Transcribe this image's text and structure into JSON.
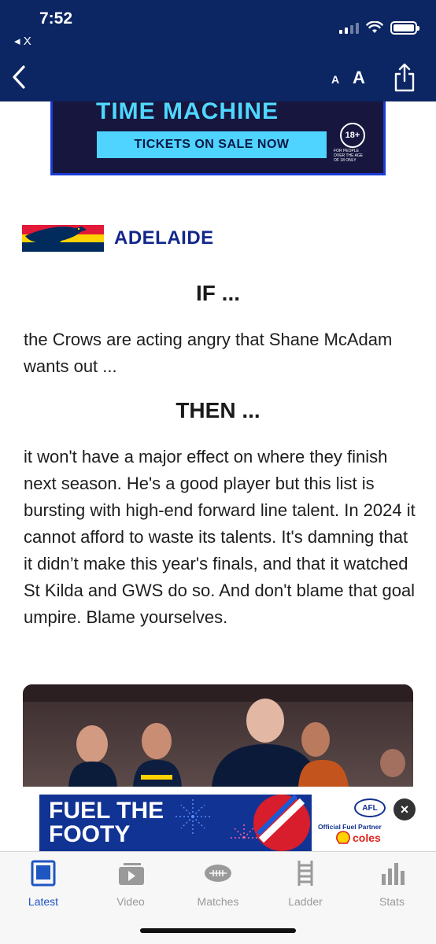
{
  "status_bar": {
    "time": "7:52",
    "back_app": "◂ X"
  },
  "nav": {
    "font_small": "A",
    "font_large": "A"
  },
  "top_ad": {
    "title": "TIME MACHINE",
    "cta": "TICKETS ON SALE NOW",
    "age_badge": "18+",
    "age_note": "FOR PEOPLE OVER THE AGE OF 18 ONLY"
  },
  "team": {
    "name": "ADELAIDE",
    "colors": [
      "#e21937",
      "#ffd200",
      "#002b5c"
    ]
  },
  "article": {
    "if_heading": "IF ...",
    "if_text": "the Crows are acting angry that Shane McAdam wants out ...",
    "then_heading": "THEN ...",
    "then_text": "it won't have a major effect on where they finish next season. He's a good player but this list is bursting with high-end forward line talent. In 2024 it cannot afford to waste its talents. It's damning that it didn’t make this year's finals, and that it watched St Kilda and GWS do so. And don't blame that goal umpire. Blame yourselves."
  },
  "bottom_ad": {
    "line1": "FUEL THE",
    "line2": "FOOTY",
    "badge": "AFL",
    "partner": "Official Fuel Partner",
    "brand": "coles",
    "close": "×"
  },
  "tabs": [
    {
      "label": "Latest",
      "icon": "latest-icon",
      "active": true
    },
    {
      "label": "Video",
      "icon": "video-icon",
      "active": false
    },
    {
      "label": "Matches",
      "icon": "football-icon",
      "active": false
    },
    {
      "label": "Ladder",
      "icon": "ladder-icon",
      "active": false
    },
    {
      "label": "Stats",
      "icon": "stats-icon",
      "active": false
    }
  ],
  "colors": {
    "header": "#0c2663",
    "accent": "#1e56c2",
    "team_blue": "#13278a"
  }
}
